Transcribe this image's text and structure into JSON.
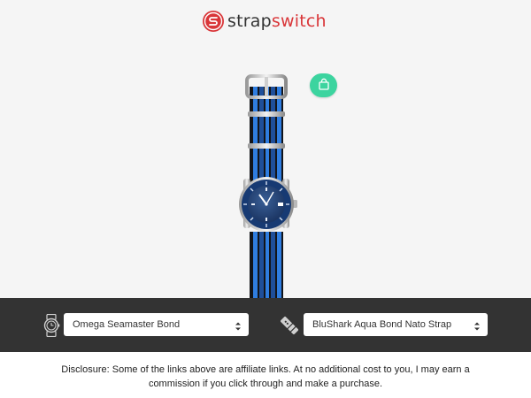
{
  "brand": {
    "name_part1": "strap",
    "name_part2": "switch",
    "accent_color": "#d93639"
  },
  "preview": {
    "watch_image": "omega-seamaster-watch-on-blue-black-nato-strap",
    "shop_icon": "shopping-bag-icon",
    "shop_button_color": "#3cd49f"
  },
  "toolbar": {
    "watch_icon": "watch-icon",
    "strap_icon": "strap-icon",
    "watch_select": {
      "value": "Omega Seamaster Bond"
    },
    "strap_select": {
      "value": "BluShark Aqua Bond Nato Strap"
    }
  },
  "disclosure": "Disclosure: Some of the links above are affiliate links. At no additional cost to you, I may earn a commission if you click through and make a purchase."
}
